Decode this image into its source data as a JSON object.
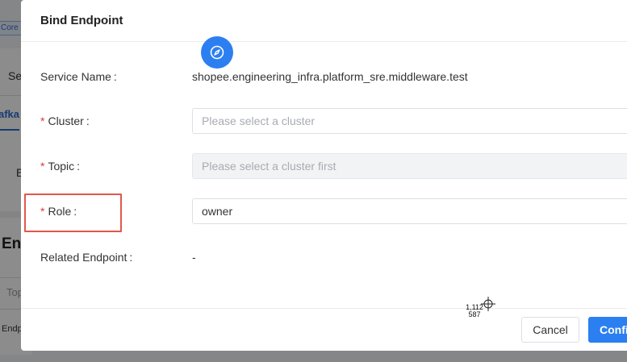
{
  "background": {
    "tag_label": "Core F",
    "fragments": [
      "Se",
      "afka",
      "E",
      "En",
      "Top",
      "Endp"
    ]
  },
  "modal": {
    "title": "Bind Endpoint",
    "fields": {
      "service_name": {
        "label": "Service Name",
        "value": "shopee.engineering_infra.platform_sre.middleware.test"
      },
      "cluster": {
        "label": "Cluster",
        "required": "*",
        "placeholder": "Please select a cluster"
      },
      "topic": {
        "label": "Topic",
        "required": "*",
        "placeholder": "Please select a cluster first"
      },
      "role": {
        "label": "Role",
        "required": "*",
        "value": "owner"
      },
      "related_endpoint": {
        "label": "Related Endpoint",
        "value": "-"
      }
    },
    "colon": ":",
    "footer": {
      "cancel_label": "Cancel",
      "confirm_label": "Confi"
    }
  },
  "cursor": {
    "x": "1,112",
    "y": "587"
  },
  "colors": {
    "primary": "#2b7ff0",
    "highlight": "#e0584c",
    "required": "#e0393e"
  }
}
